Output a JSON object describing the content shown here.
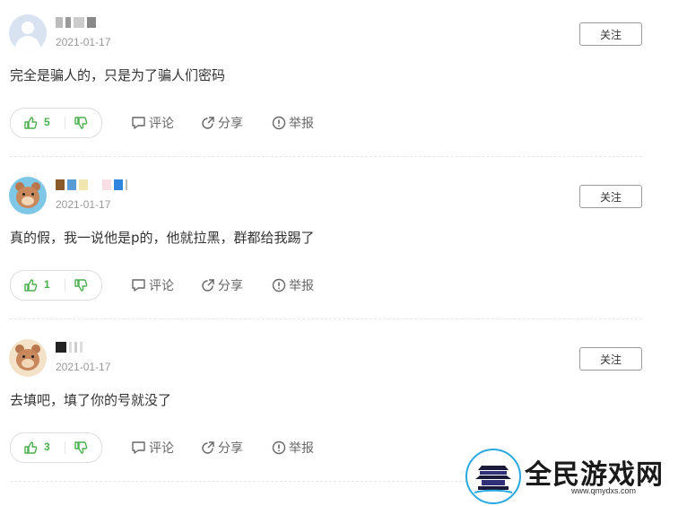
{
  "comments": [
    {
      "avatar": "default-avatar",
      "date": "2021-01-17",
      "follow_label": "关注",
      "text": "完全是骗人的，只是为了骗人们密码",
      "likes": "5"
    },
    {
      "avatar": "bear-avatar",
      "date": "2021-01-17",
      "follow_label": "关注",
      "text": "真的假，我一说他是p的，他就拉黑，群都给我踢了",
      "likes": "1"
    },
    {
      "avatar": "bear-avatar",
      "date": "2021-01-17",
      "follow_label": "关注",
      "text": "去填吧，填了你的号就没了",
      "likes": "3"
    }
  ],
  "actions": {
    "comment_label": "评论",
    "share_label": "分享",
    "report_label": "举报"
  },
  "icons": {
    "like": "thumbs-up-icon",
    "dislike": "thumbs-down-icon",
    "comment": "comment-icon",
    "share": "share-icon",
    "report": "report-icon"
  },
  "colors": {
    "like_green": "#4caf50",
    "text": "#333333",
    "muted": "#999999",
    "watermark_blue": "#29a9e1"
  },
  "watermark": {
    "title": "全民游戏网",
    "url": "www.qmydxs.com"
  }
}
